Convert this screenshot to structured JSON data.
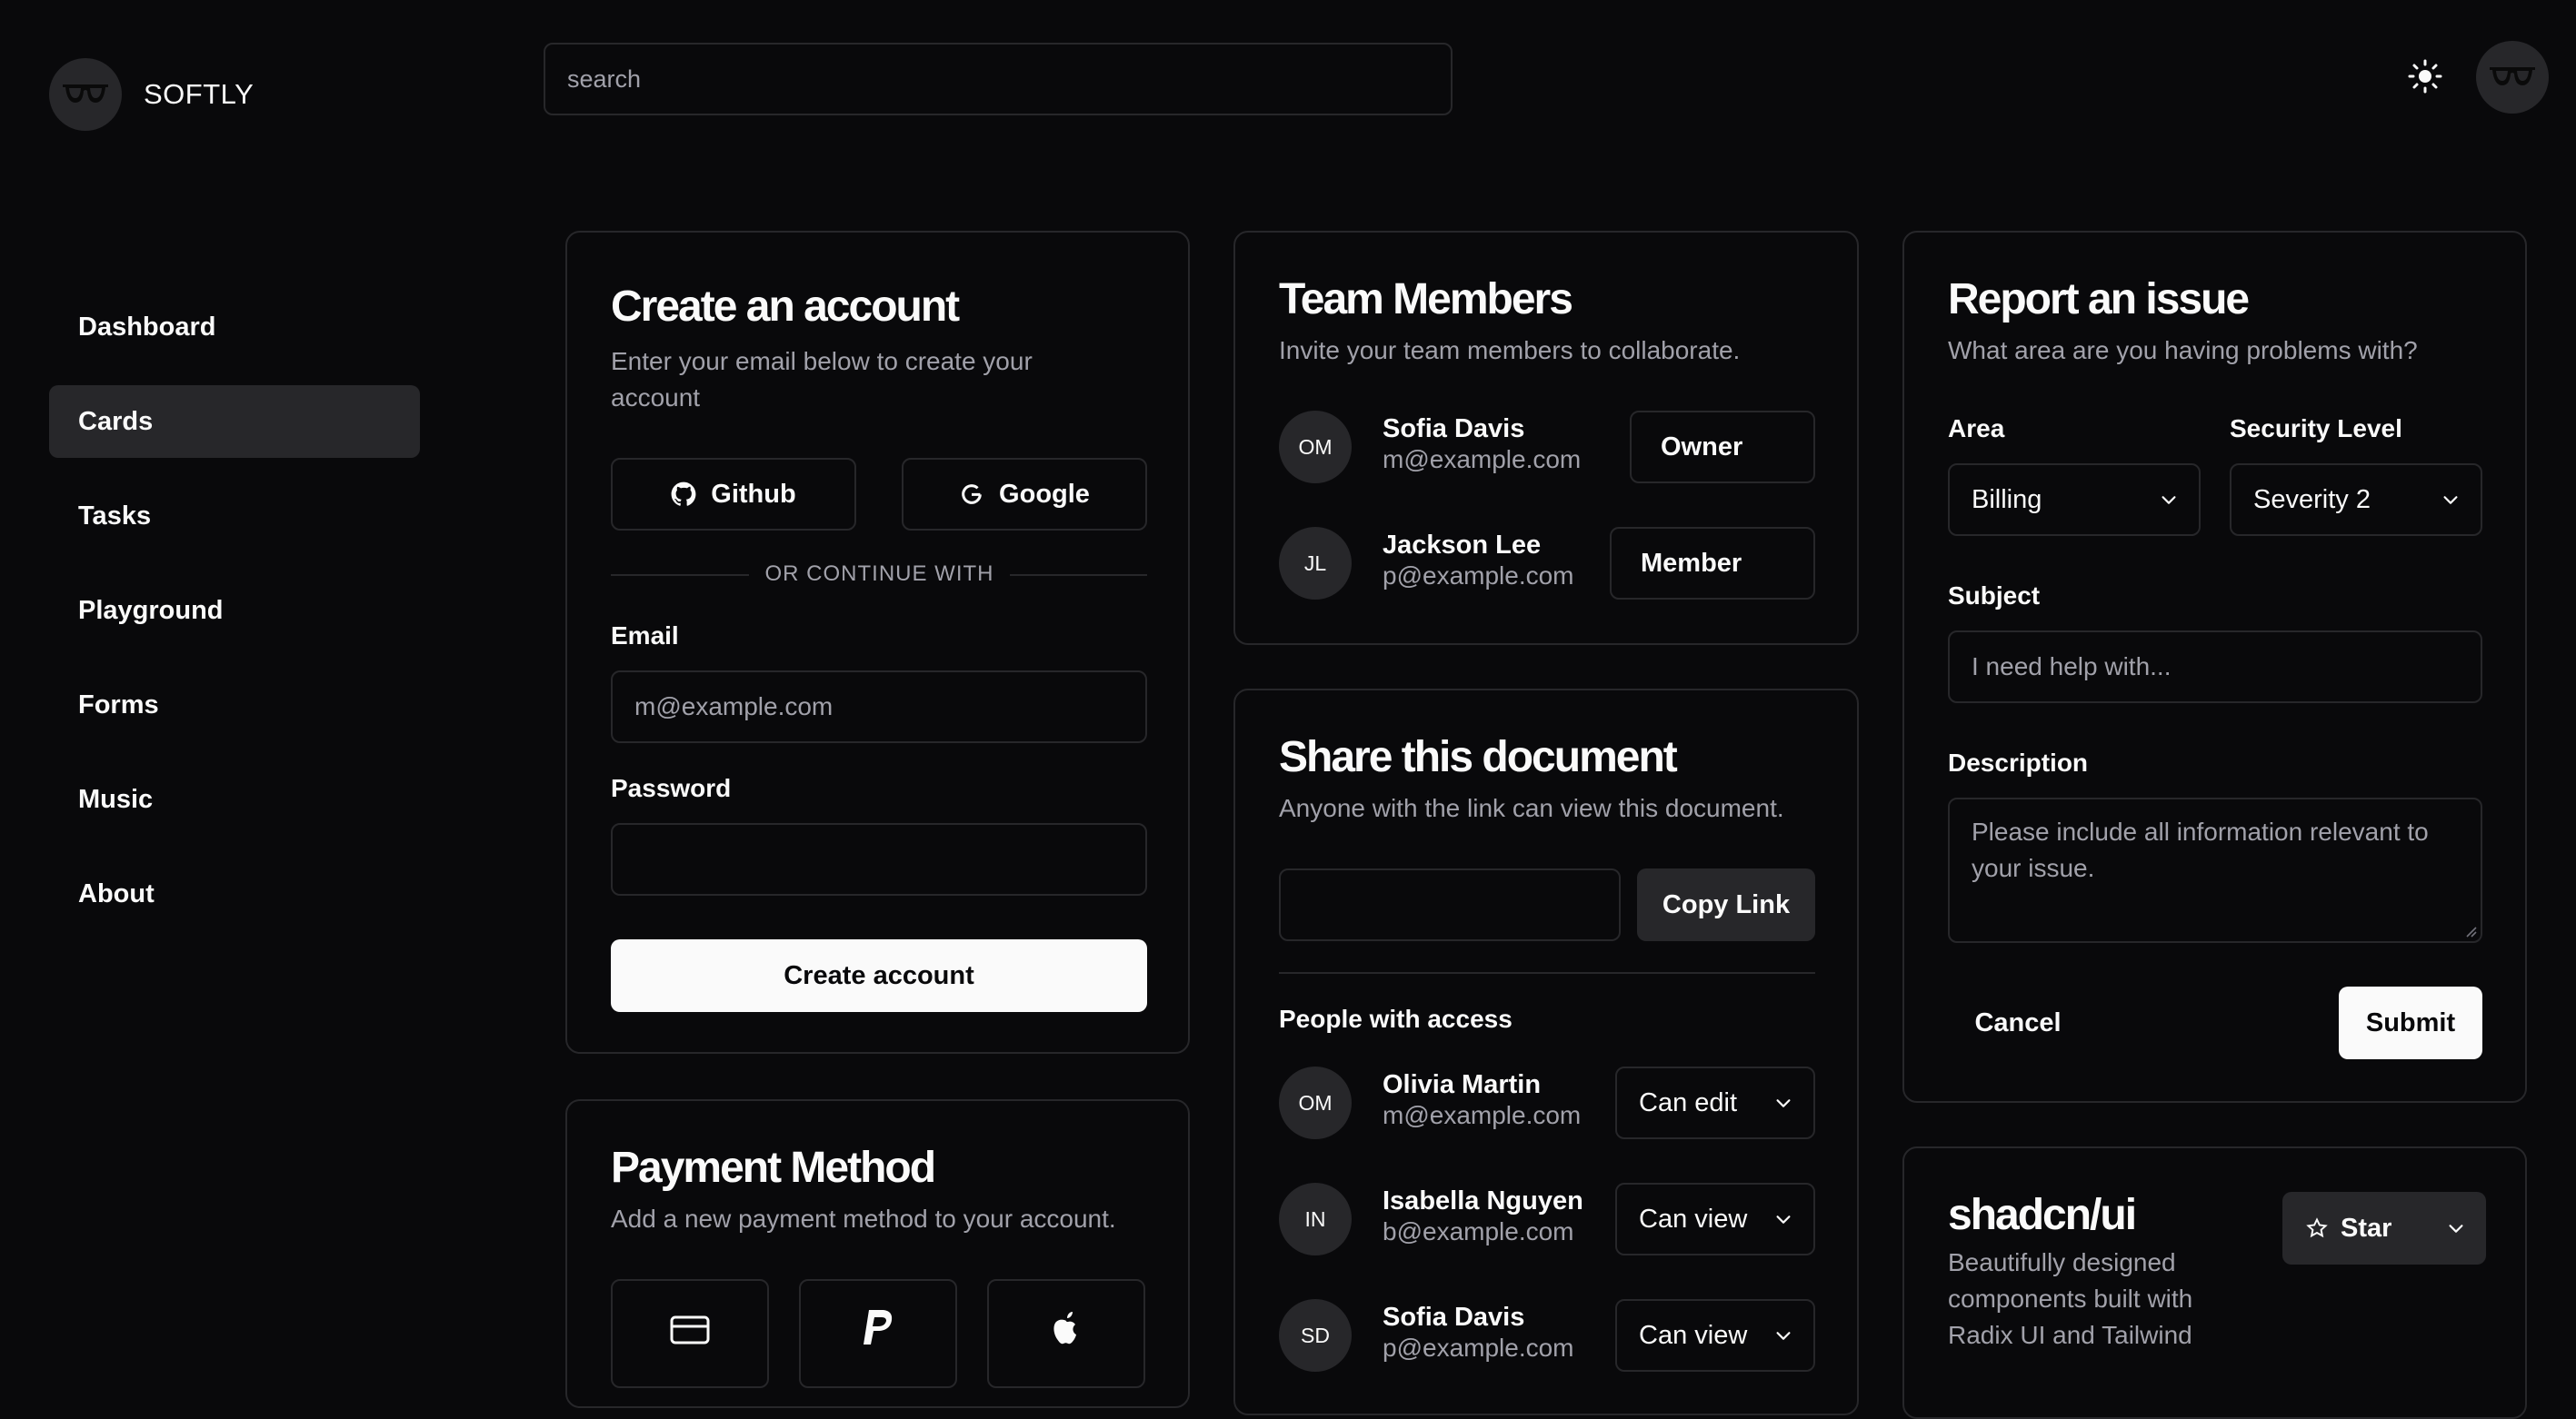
{
  "app": {
    "brand": "SOFTLY"
  },
  "search": {
    "placeholder": "search"
  },
  "sidebar": {
    "items": [
      {
        "label": "Dashboard"
      },
      {
        "label": "Cards"
      },
      {
        "label": "Tasks"
      },
      {
        "label": "Playground"
      },
      {
        "label": "Forms"
      },
      {
        "label": "Music"
      },
      {
        "label": "About"
      }
    ],
    "active": "Cards"
  },
  "create_account": {
    "title": "Create an account",
    "description": "Enter your email below to create your account",
    "github_label": "Github",
    "google_label": "Google",
    "divider": "OR CONTINUE WITH",
    "email_label": "Email",
    "email_placeholder": "m@example.com",
    "password_label": "Password",
    "submit_label": "Create account"
  },
  "payment": {
    "title": "Payment Method",
    "description": "Add a new payment method to your account."
  },
  "team": {
    "title": "Team Members",
    "description": "Invite your team members to collaborate.",
    "members": [
      {
        "initials": "OM",
        "name": "Sofia Davis",
        "email": "m@example.com",
        "role": "Owner"
      },
      {
        "initials": "JL",
        "name": "Jackson Lee",
        "email": "p@example.com",
        "role": "Member"
      }
    ]
  },
  "share": {
    "title": "Share this document",
    "description": "Anyone with the link can view this document.",
    "copy_label": "Copy Link",
    "people_heading": "People with access",
    "people": [
      {
        "initials": "OM",
        "name": "Olivia Martin",
        "email": "m@example.com",
        "permission": "Can edit"
      },
      {
        "initials": "IN",
        "name": "Isabella Nguyen",
        "email": "b@example.com",
        "permission": "Can view"
      },
      {
        "initials": "SD",
        "name": "Sofia Davis",
        "email": "p@example.com",
        "permission": "Can view"
      }
    ]
  },
  "report": {
    "title": "Report an issue",
    "description": "What area are you having problems with?",
    "area_label": "Area",
    "area_value": "Billing",
    "security_label": "Security Level",
    "security_value": "Severity 2",
    "subject_label": "Subject",
    "subject_placeholder": "I need help with...",
    "description_label": "Description",
    "description_placeholder": "Please include all information relevant to your issue.",
    "cancel_label": "Cancel",
    "submit_label": "Submit"
  },
  "repo": {
    "title": "shadcn/ui",
    "description": "Beautifully designed components built with Radix UI and Tailwind",
    "star_label": "Star"
  }
}
